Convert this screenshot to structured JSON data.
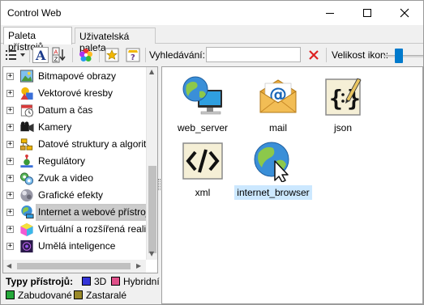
{
  "window": {
    "title": "Control Web"
  },
  "tabs": [
    {
      "label": "Paleta přístrojů",
      "active": true
    },
    {
      "label": "Uživatelská paleta",
      "active": false
    }
  ],
  "toolbar": {
    "search_label": "Vyhledávání:",
    "search_value": "",
    "icon_size_label": "Velikost ikon:",
    "icon_size_level": 0.35
  },
  "tree": {
    "items": [
      {
        "label": "Bitmapové obrazy",
        "icon": "bitmap-image-icon",
        "selected": false
      },
      {
        "label": "Vektorové kresby",
        "icon": "vector-drawing-icon",
        "selected": false
      },
      {
        "label": "Datum a čas",
        "icon": "calendar-icon",
        "selected": false
      },
      {
        "label": "Kamery",
        "icon": "camera-icon",
        "selected": false
      },
      {
        "label": "Datové struktury a algoritmy",
        "icon": "data-structures-icon",
        "selected": false
      },
      {
        "label": "Regulátory",
        "icon": "regulator-icon",
        "selected": false
      },
      {
        "label": "Zvuk a video",
        "icon": "sound-video-icon",
        "selected": false
      },
      {
        "label": "Grafické efekty",
        "icon": "graphic-effects-icon",
        "selected": false
      },
      {
        "label": "Internet a webové přístroje",
        "icon": "internet-globe-icon",
        "selected": true
      },
      {
        "label": "Virtuální a rozšířená realita",
        "icon": "virtual-reality-icon",
        "selected": false
      },
      {
        "label": "Umělá inteligence",
        "icon": "ai-chip-icon",
        "selected": false
      }
    ]
  },
  "legend": {
    "title": "Typy přístrojů:",
    "items": [
      {
        "label": "3D",
        "color": "#3535d8"
      },
      {
        "label": "Hybridní",
        "color": "#e0508a"
      },
      {
        "label": "Zabudované",
        "color": "#25a83a"
      },
      {
        "label": "Zastaralé",
        "color": "#9a8a2a"
      }
    ]
  },
  "instruments": [
    {
      "label": "web_server",
      "icon": "web-server-icon",
      "selected": false
    },
    {
      "label": "mail",
      "icon": "mail-icon",
      "selected": false
    },
    {
      "label": "json",
      "icon": "json-icon",
      "selected": false
    },
    {
      "label": "xml",
      "icon": "xml-icon",
      "selected": false
    },
    {
      "label": "internet_browser",
      "icon": "internet-browser-icon",
      "selected": true
    }
  ],
  "colors": {
    "accent": "#007acc",
    "selection": "#cce8ff",
    "tree_selection": "#c8c8c8"
  }
}
